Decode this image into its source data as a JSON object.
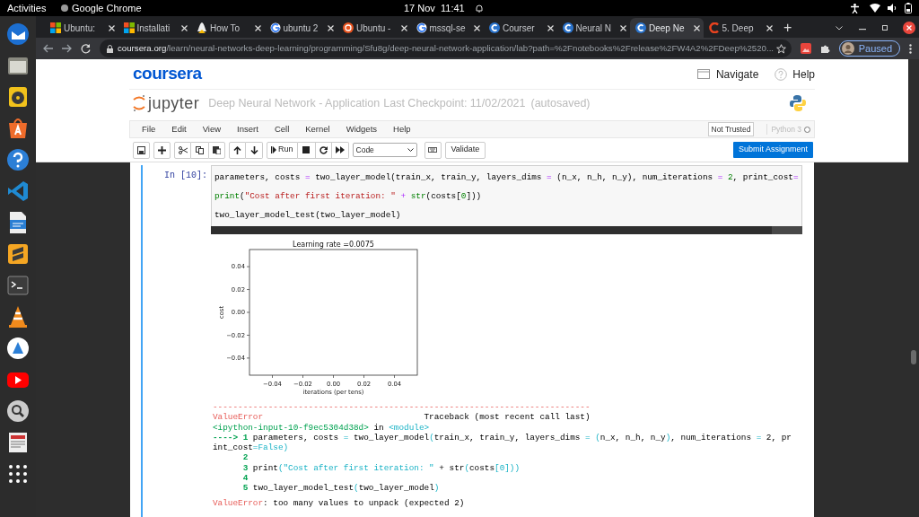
{
  "topbar": {
    "activities": "Activities",
    "app": "Google Chrome",
    "date": "17 Nov",
    "time": "11:41"
  },
  "tabs": [
    {
      "label": "Ubuntu:",
      "kind": "windows",
      "selected": false
    },
    {
      "label": "Installati",
      "kind": "windows",
      "selected": false
    },
    {
      "label": "How To",
      "kind": "tux",
      "selected": false
    },
    {
      "label": "ubuntu 2",
      "kind": "google",
      "selected": false
    },
    {
      "label": "Ubuntu -",
      "kind": "ubuntu",
      "selected": false
    },
    {
      "label": "mssql-se",
      "kind": "google",
      "selected": false
    },
    {
      "label": "Courser",
      "kind": "coursera",
      "selected": false
    },
    {
      "label": "Neural N",
      "kind": "coursera",
      "selected": false
    },
    {
      "label": "Deep Ne",
      "kind": "coursera",
      "selected": true
    },
    {
      "label": "5. Deep",
      "kind": "orangec",
      "selected": false
    }
  ],
  "new_tab": "+",
  "address": {
    "host": "coursera.org",
    "path": "/learn/neural-networks-deep-learning/programming/Sfu8g/deep-neural-network-application/lab?path=%2Fnotebooks%2Frelease%2FW4A2%2FDeep%2520..."
  },
  "profile": {
    "label": "Paused"
  },
  "coursera": {
    "logo": "coursera",
    "navigate": "Navigate",
    "help": "Help"
  },
  "jupyter": {
    "logo": "jupyter",
    "notebook_name": "Deep Neural Network - Application",
    "checkpoint": "Last Checkpoint: 11/02/2021",
    "autosave": "(autosaved)"
  },
  "menu": [
    "File",
    "Edit",
    "View",
    "Insert",
    "Cell",
    "Kernel",
    "Widgets",
    "Help"
  ],
  "trust": "Not Trusted",
  "kernel": {
    "name": "Python 3",
    "busy": false
  },
  "toolbar": {
    "run": "Run",
    "cell_type": "Code",
    "validate": "Validate",
    "submit": "Submit Assignment"
  },
  "cell": {
    "prompt": "In [10]:",
    "selected": true,
    "input": [
      [
        {
          "text": "parameters, costs ",
          "kind": "plain"
        },
        {
          "text": "=",
          "kind": "op"
        },
        {
          "text": " two_layer_model(train_x, train_y, layers_dims ",
          "kind": "plain"
        },
        {
          "text": "=",
          "kind": "op"
        },
        {
          "text": " (n_x, n_h, n_y), num_iterations ",
          "kind": "plain"
        },
        {
          "text": "=",
          "kind": "op"
        },
        {
          "text": " 2",
          "kind": "num"
        },
        {
          "text": ", print_cost",
          "kind": "plain"
        },
        {
          "text": "=",
          "kind": "op"
        }
      ],
      [
        {
          "text": "print",
          "kind": "builtin"
        },
        {
          "text": "(",
          "kind": "plain"
        },
        {
          "text": "\"Cost after first iteration: \"",
          "kind": "str"
        },
        {
          "text": " +",
          "kind": "op"
        },
        {
          "text": " str",
          "kind": "builtin"
        },
        {
          "text": "(costs[",
          "kind": "plain"
        },
        {
          "text": "0",
          "kind": "num"
        },
        {
          "text": "]))",
          "kind": "plain"
        }
      ],
      [
        {
          "text": "two_layer_model_test(two_layer_model)",
          "kind": "plain"
        }
      ]
    ],
    "chart_data": {
      "type": "line",
      "title": "Learning rate =0.0075",
      "xlabel": "iterations (per tens)",
      "ylabel": "cost",
      "xlim": [
        -0.055,
        0.055
      ],
      "ylim": [
        -0.055,
        0.055
      ],
      "xticks": [
        {
          "value": -0.04,
          "label": "−0.04"
        },
        {
          "value": -0.02,
          "label": "−0.02"
        },
        {
          "value": 0,
          "label": "0.00"
        },
        {
          "value": 0.02,
          "label": "0.02"
        },
        {
          "value": 0.04,
          "label": "0.04"
        }
      ],
      "yticks": [
        {
          "value": -0.04,
          "label": "−0.04"
        },
        {
          "value": -0.02,
          "label": "−0.02"
        },
        {
          "value": 0,
          "label": "0.00"
        },
        {
          "value": 0.02,
          "label": "0.02"
        },
        {
          "value": 0.04,
          "label": "0.04"
        }
      ]
    },
    "traceback": [
      [
        {
          "text": "---------------------------------------------------------------------------",
          "kind": "err"
        }
      ],
      [
        {
          "text": "ValueError",
          "kind": "err"
        },
        {
          "text": "                                Traceback (most recent call last)",
          "kind": "plain"
        }
      ],
      [
        {
          "text": "<ipython-input-10-f9ec5304d38d>",
          "kind": "loc"
        },
        {
          "text": " in ",
          "kind": "plain"
        },
        {
          "text": "<module>",
          "kind": "cyan"
        }
      ],
      [
        {
          "text": "----> 1 ",
          "kind": "lineno"
        },
        {
          "text": "parameters, costs ",
          "kind": "plain"
        },
        {
          "text": "=",
          "kind": "cyan"
        },
        {
          "text": " two_layer_model",
          "kind": "plain"
        },
        {
          "text": "(",
          "kind": "cyan"
        },
        {
          "text": "train_x, train_y, layers_dims ",
          "kind": "plain"
        },
        {
          "text": "= (",
          "kind": "cyan"
        },
        {
          "text": "n_x, n_h, n_y",
          "kind": "plain"
        },
        {
          "text": ")",
          "kind": "cyan"
        },
        {
          "text": ", num_iterations ",
          "kind": "plain"
        },
        {
          "text": "=",
          "kind": "cyan"
        },
        {
          "text": " 2, pr",
          "kind": "plain"
        }
      ],
      [
        {
          "text": "int_cost",
          "kind": "plain"
        },
        {
          "text": "=False)",
          "kind": "cyan"
        }
      ],
      [
        {
          "text": "      2",
          "kind": "lineno"
        }
      ],
      [
        {
          "text": "      3 ",
          "kind": "lineno"
        },
        {
          "text": "print",
          "kind": "plain"
        },
        {
          "text": "(\"Cost after first iteration: \"",
          "kind": "cyan"
        },
        {
          "text": " + str",
          "kind": "plain"
        },
        {
          "text": "(",
          "kind": "cyan"
        },
        {
          "text": "costs",
          "kind": "plain"
        },
        {
          "text": "[0]))",
          "kind": "cyan"
        }
      ],
      [
        {
          "text": "      4",
          "kind": "lineno"
        }
      ],
      [
        {
          "text": "      5 ",
          "kind": "lineno"
        },
        {
          "text": "two_layer_model_test",
          "kind": "plain"
        },
        {
          "text": "(",
          "kind": "cyan"
        },
        {
          "text": "two_layer_model",
          "kind": "plain"
        },
        {
          "text": ")",
          "kind": "cyan"
        }
      ]
    ],
    "error_message": [
      {
        "text": "ValueError",
        "kind": "err"
      },
      {
        "text": ": too many values to unpack (expected 2)",
        "kind": "plain"
      }
    ]
  }
}
